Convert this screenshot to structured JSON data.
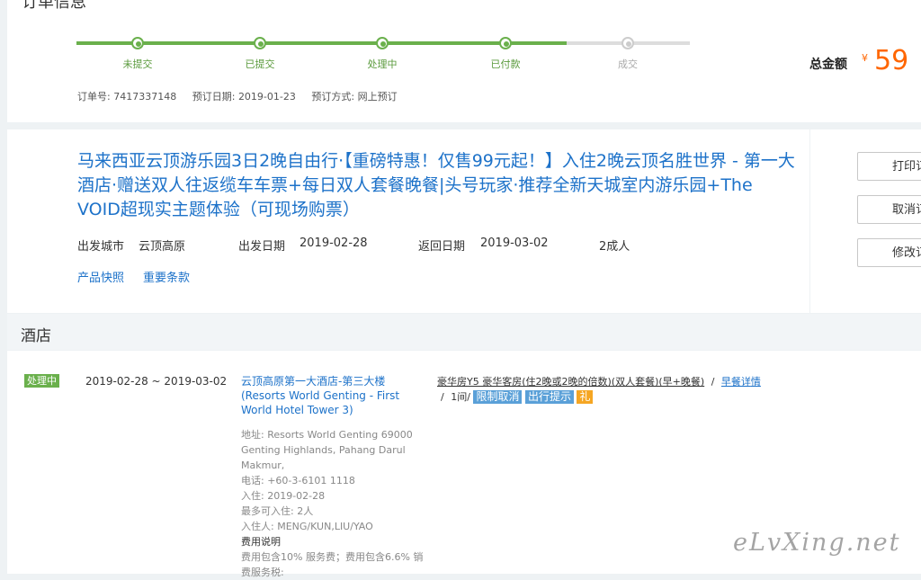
{
  "order": {
    "section_title": "订单信息",
    "steps": [
      {
        "label": "未提交",
        "done": true
      },
      {
        "label": "已提交",
        "done": true
      },
      {
        "label": "处理中",
        "done": true
      },
      {
        "label": "已付款",
        "done": true
      },
      {
        "label": "成交",
        "done": false
      }
    ],
    "meta": {
      "order_no_label": "订单号:",
      "order_no": "7417337148",
      "date_label": "预订日期:",
      "date": "2019-01-23",
      "method_label": "预订方式:",
      "method": "网上预订"
    },
    "total_label": "总金额",
    "currency": "¥",
    "total": "59",
    "colors": {
      "progress": "#6ab04c",
      "price": "#ff6600",
      "link": "#1d72c9"
    }
  },
  "product": {
    "title": "马来西亚云顶游乐园3日2晚自由行·【重磅特惠！仅售99元起！】入住2晚云顶名胜世界 - 第一大酒店·赠送双人往返缆车车票+每日双人套餐晚餐|头号玩家·推荐全新天城室内游乐园+The VOID超现实主题体验（可现场购票）",
    "depart_city_label": "出发城市",
    "depart_city": "云顶高原",
    "depart_date_label": "出发日期",
    "depart_date": "2019-02-28",
    "return_date_label": "返回日期",
    "return_date": "2019-03-02",
    "travelers": "2成人",
    "links": [
      "产品快照",
      "重要条款"
    ],
    "actions": [
      "打印订",
      "取消订",
      "修改订"
    ]
  },
  "hotel": {
    "section_title": "酒店",
    "status": "处理中",
    "dates": "2019-02-28 ~ 2019-03-02",
    "name": "云顶高原第一大酒店-第三大楼(Resorts World Genting - First World Hotel Tower 3)",
    "address_label": "地址:",
    "address": "Resorts World Genting 69000 Genting Highlands, Pahang Darul Makmur,",
    "phone_label": "电话:",
    "phone": "+60-3-6101 1118",
    "checkin_label": "入住:",
    "checkin": "2019-02-28",
    "max_label": "最多可入住:",
    "max": "2人",
    "guests_label": "入住人:",
    "guests": "MENG/KUN,LIU/YAO",
    "fee_heading": "费用说明",
    "fee_text": "费用包含10% 服务费；费用包含6.6% 销",
    "fee_more": "费服务税:",
    "room_desc": "豪华房Y5 豪华客房(住2晚或2晚的倍数)(双人套餐)(早+晚餐)",
    "sep1": "/",
    "breakfast_link_1": "早餐详",
    "breakfast_link_2": "情",
    "sep2": "/",
    "rooms": "1间/",
    "tag_cancel": "限制取消",
    "tag_travel": "出行提示",
    "tag_gift": "礼"
  },
  "watermark": "eLvXing.net"
}
